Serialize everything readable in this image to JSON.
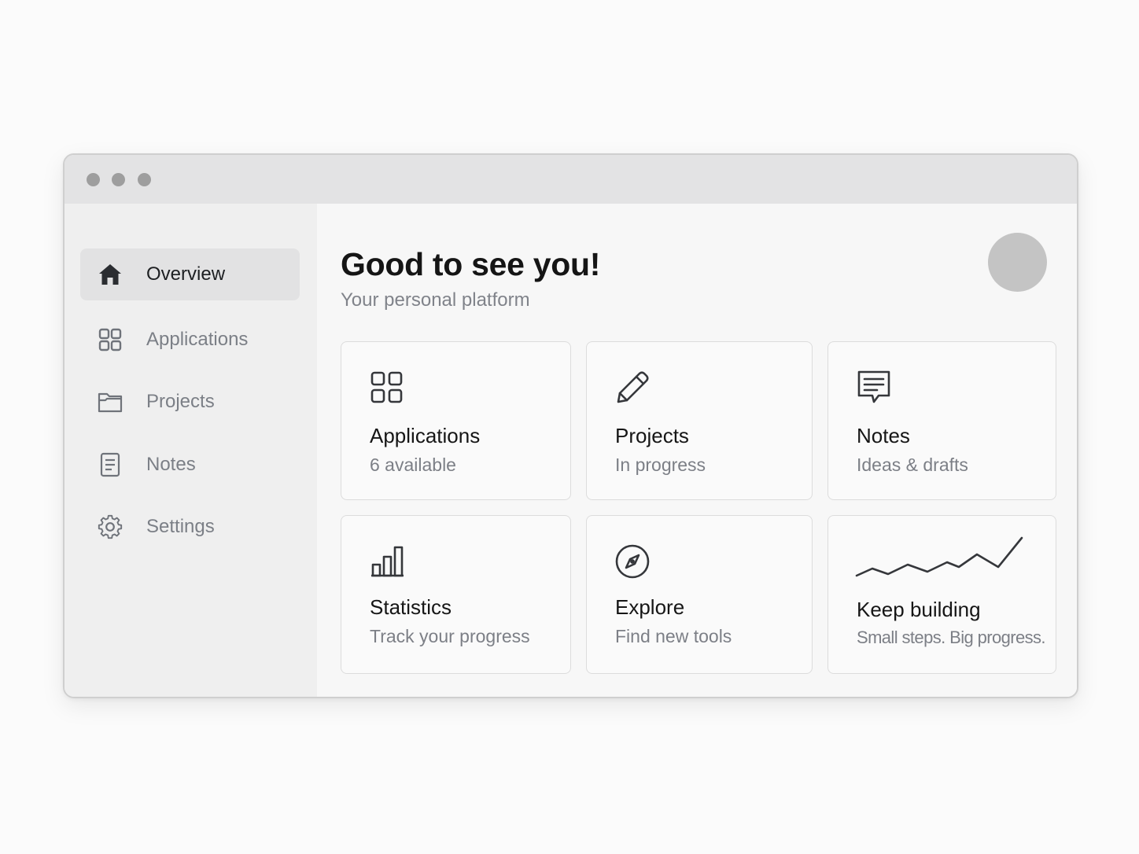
{
  "window": {
    "traffic_lights": [
      "close-dot",
      "minimize-dot",
      "maximize-dot"
    ]
  },
  "sidebar": {
    "items": [
      {
        "label": "Overview",
        "icon": "home-icon",
        "active": true
      },
      {
        "label": "Applications",
        "icon": "grid-icon",
        "active": false
      },
      {
        "label": "Projects",
        "icon": "folder-icon",
        "active": false
      },
      {
        "label": "Notes",
        "icon": "document-icon",
        "active": false
      },
      {
        "label": "Settings",
        "icon": "gear-icon",
        "active": false
      }
    ]
  },
  "main": {
    "greeting": "Good to see you!",
    "subtitle": "Your personal platform",
    "avatar": "user-avatar",
    "cards": [
      {
        "title": "Applications",
        "subtitle": "6 available",
        "icon": "grid-icon"
      },
      {
        "title": "Projects",
        "subtitle": "In progress",
        "icon": "pencil-icon"
      },
      {
        "title": "Notes",
        "subtitle": "Ideas & drafts",
        "icon": "note-icon"
      },
      {
        "title": "Statistics",
        "subtitle": "Track your progress",
        "icon": "bar-chart-icon"
      },
      {
        "title": "Explore",
        "subtitle": "Find new tools",
        "icon": "compass-icon"
      },
      {
        "title": "Keep building",
        "subtitle": "Small steps. Big progress.",
        "icon": "trend-line-icon"
      }
    ]
  },
  "colors": {
    "window_bg": "#f7f7f7",
    "titlebar_bg": "#e3e3e4",
    "sidebar_bg": "#efefef",
    "active_item_bg": "#e2e2e3",
    "avatar": "#c4c4c4",
    "muted_text": "#7b7f86",
    "primary_text": "#151515"
  }
}
